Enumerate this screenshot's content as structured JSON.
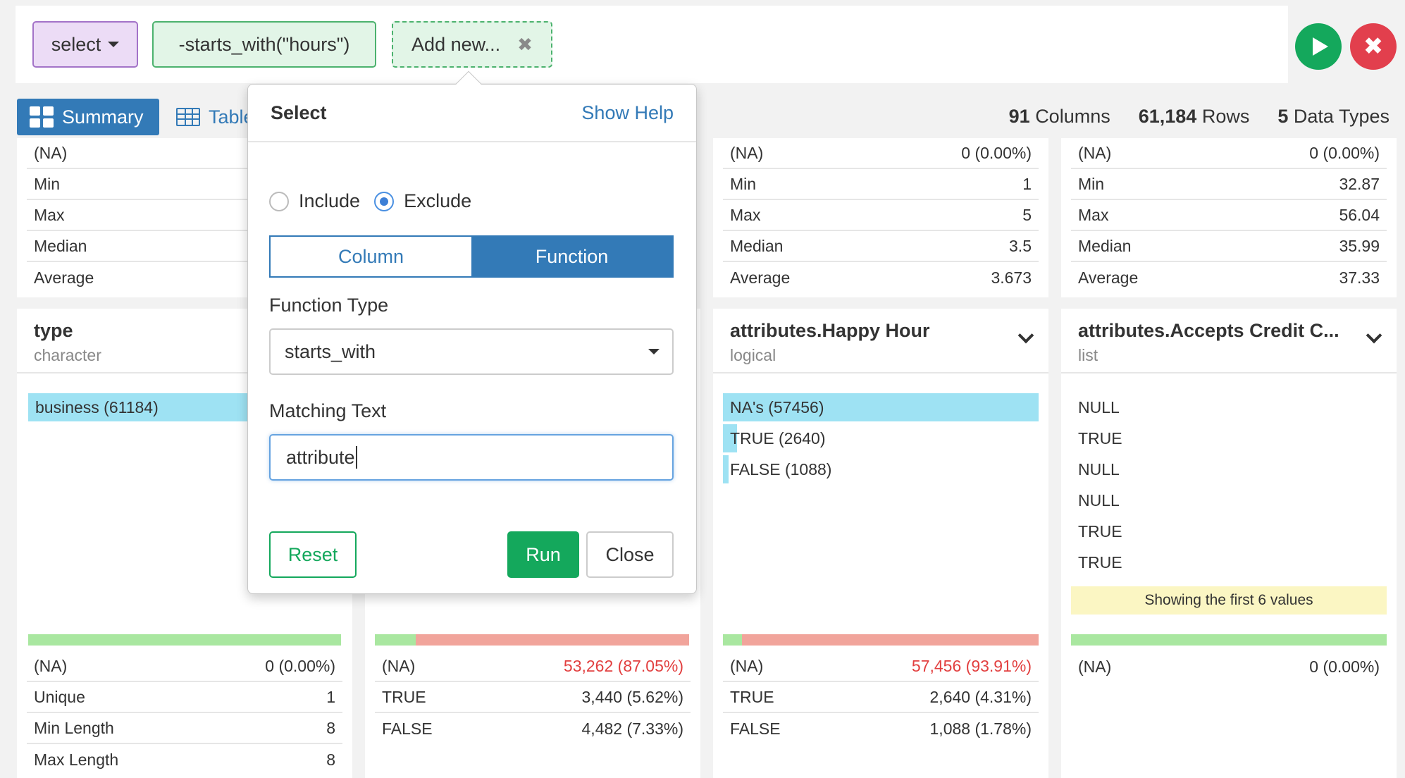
{
  "command_bar": {
    "select_token": "select",
    "expression_token": "-starts_with(\"hours\")",
    "add_new_token": "Add new...",
    "add_new_remove_glyph": "✖",
    "run_glyph": "play-icon",
    "cancel_glyph": "✖"
  },
  "view_tabs": {
    "summary": "Summary",
    "table": "Table"
  },
  "stats": {
    "columns_count": "91",
    "columns_label": "Columns",
    "rows_count": "61,184",
    "rows_label": "Rows",
    "types_count": "5",
    "types_label": "Data Types"
  },
  "top_cards": {
    "left": {
      "rows": [
        {
          "k": "(NA)",
          "v": ""
        },
        {
          "k": "Min",
          "v": ""
        },
        {
          "k": "Max",
          "v": ""
        },
        {
          "k": "Median",
          "v": ""
        },
        {
          "k": "Average",
          "v": ""
        }
      ]
    },
    "c3": {
      "rows": [
        {
          "k": "(NA)",
          "v": "0 (0.00%)"
        },
        {
          "k": "Min",
          "v": "1"
        },
        {
          "k": "Max",
          "v": "5"
        },
        {
          "k": "Median",
          "v": "3.5"
        },
        {
          "k": "Average",
          "v": "3.673"
        }
      ]
    },
    "c4": {
      "rows": [
        {
          "k": "(NA)",
          "v": "0 (0.00%)"
        },
        {
          "k": "Min",
          "v": "32.87"
        },
        {
          "k": "Max",
          "v": "56.04"
        },
        {
          "k": "Median",
          "v": "35.99"
        },
        {
          "k": "Average",
          "v": "37.33"
        }
      ]
    }
  },
  "columns": {
    "c1": {
      "name": "type",
      "type": "character",
      "bar_label": "business (61184)",
      "stats": [
        {
          "k": "(NA)",
          "v": "0 (0.00%)"
        },
        {
          "k": "Unique",
          "v": "1"
        },
        {
          "k": "Min Length",
          "v": "8"
        },
        {
          "k": "Max Length",
          "v": "8"
        }
      ]
    },
    "c2": {
      "stats": [
        {
          "k": "(NA)",
          "v": "53,262 (87.05%)"
        },
        {
          "k": "TRUE",
          "v": "3,440 (5.62%)"
        },
        {
          "k": "FALSE",
          "v": "4,482 (7.33%)"
        }
      ]
    },
    "c3": {
      "name": "attributes.Happy Hour",
      "type": "logical",
      "bars": [
        {
          "label": "NA's (57456)",
          "fraction": 1.0
        },
        {
          "label": "TRUE (2640)",
          "fraction": 0.046
        },
        {
          "label": "FALSE (1088)",
          "fraction": 0.019
        }
      ],
      "stats": [
        {
          "k": "(NA)",
          "v": "57,456 (93.91%)"
        },
        {
          "k": "TRUE",
          "v": "2,640 (4.31%)"
        },
        {
          "k": "FALSE",
          "v": "1,088 (1.78%)"
        }
      ]
    },
    "c4": {
      "name": "attributes.Accepts Credit C...",
      "type": "list",
      "values": [
        "NULL",
        "TRUE",
        "NULL",
        "NULL",
        "TRUE",
        "TRUE"
      ],
      "note": "Showing the first 6 values",
      "stats": [
        {
          "k": "(NA)",
          "v": "0 (0.00%)"
        }
      ]
    }
  },
  "popover": {
    "title": "Select",
    "help_link": "Show Help",
    "include_label": "Include",
    "exclude_label": "Exclude",
    "mode_column": "Column",
    "mode_function": "Function",
    "function_type_label": "Function Type",
    "function_type_value": "starts_with",
    "matching_text_label": "Matching Text",
    "matching_text_value": "attribute",
    "reset_label": "Reset",
    "run_label": "Run",
    "close_label": "Close"
  },
  "colors": {
    "accent": "#337ab7",
    "run_green": "#14a85c",
    "cancel_red": "#e23f4d",
    "bar_blue": "#9ee2f3",
    "quality_green": "#a9e7a0",
    "quality_red": "#f1a49b",
    "note_yellow": "#fbf6c3"
  }
}
